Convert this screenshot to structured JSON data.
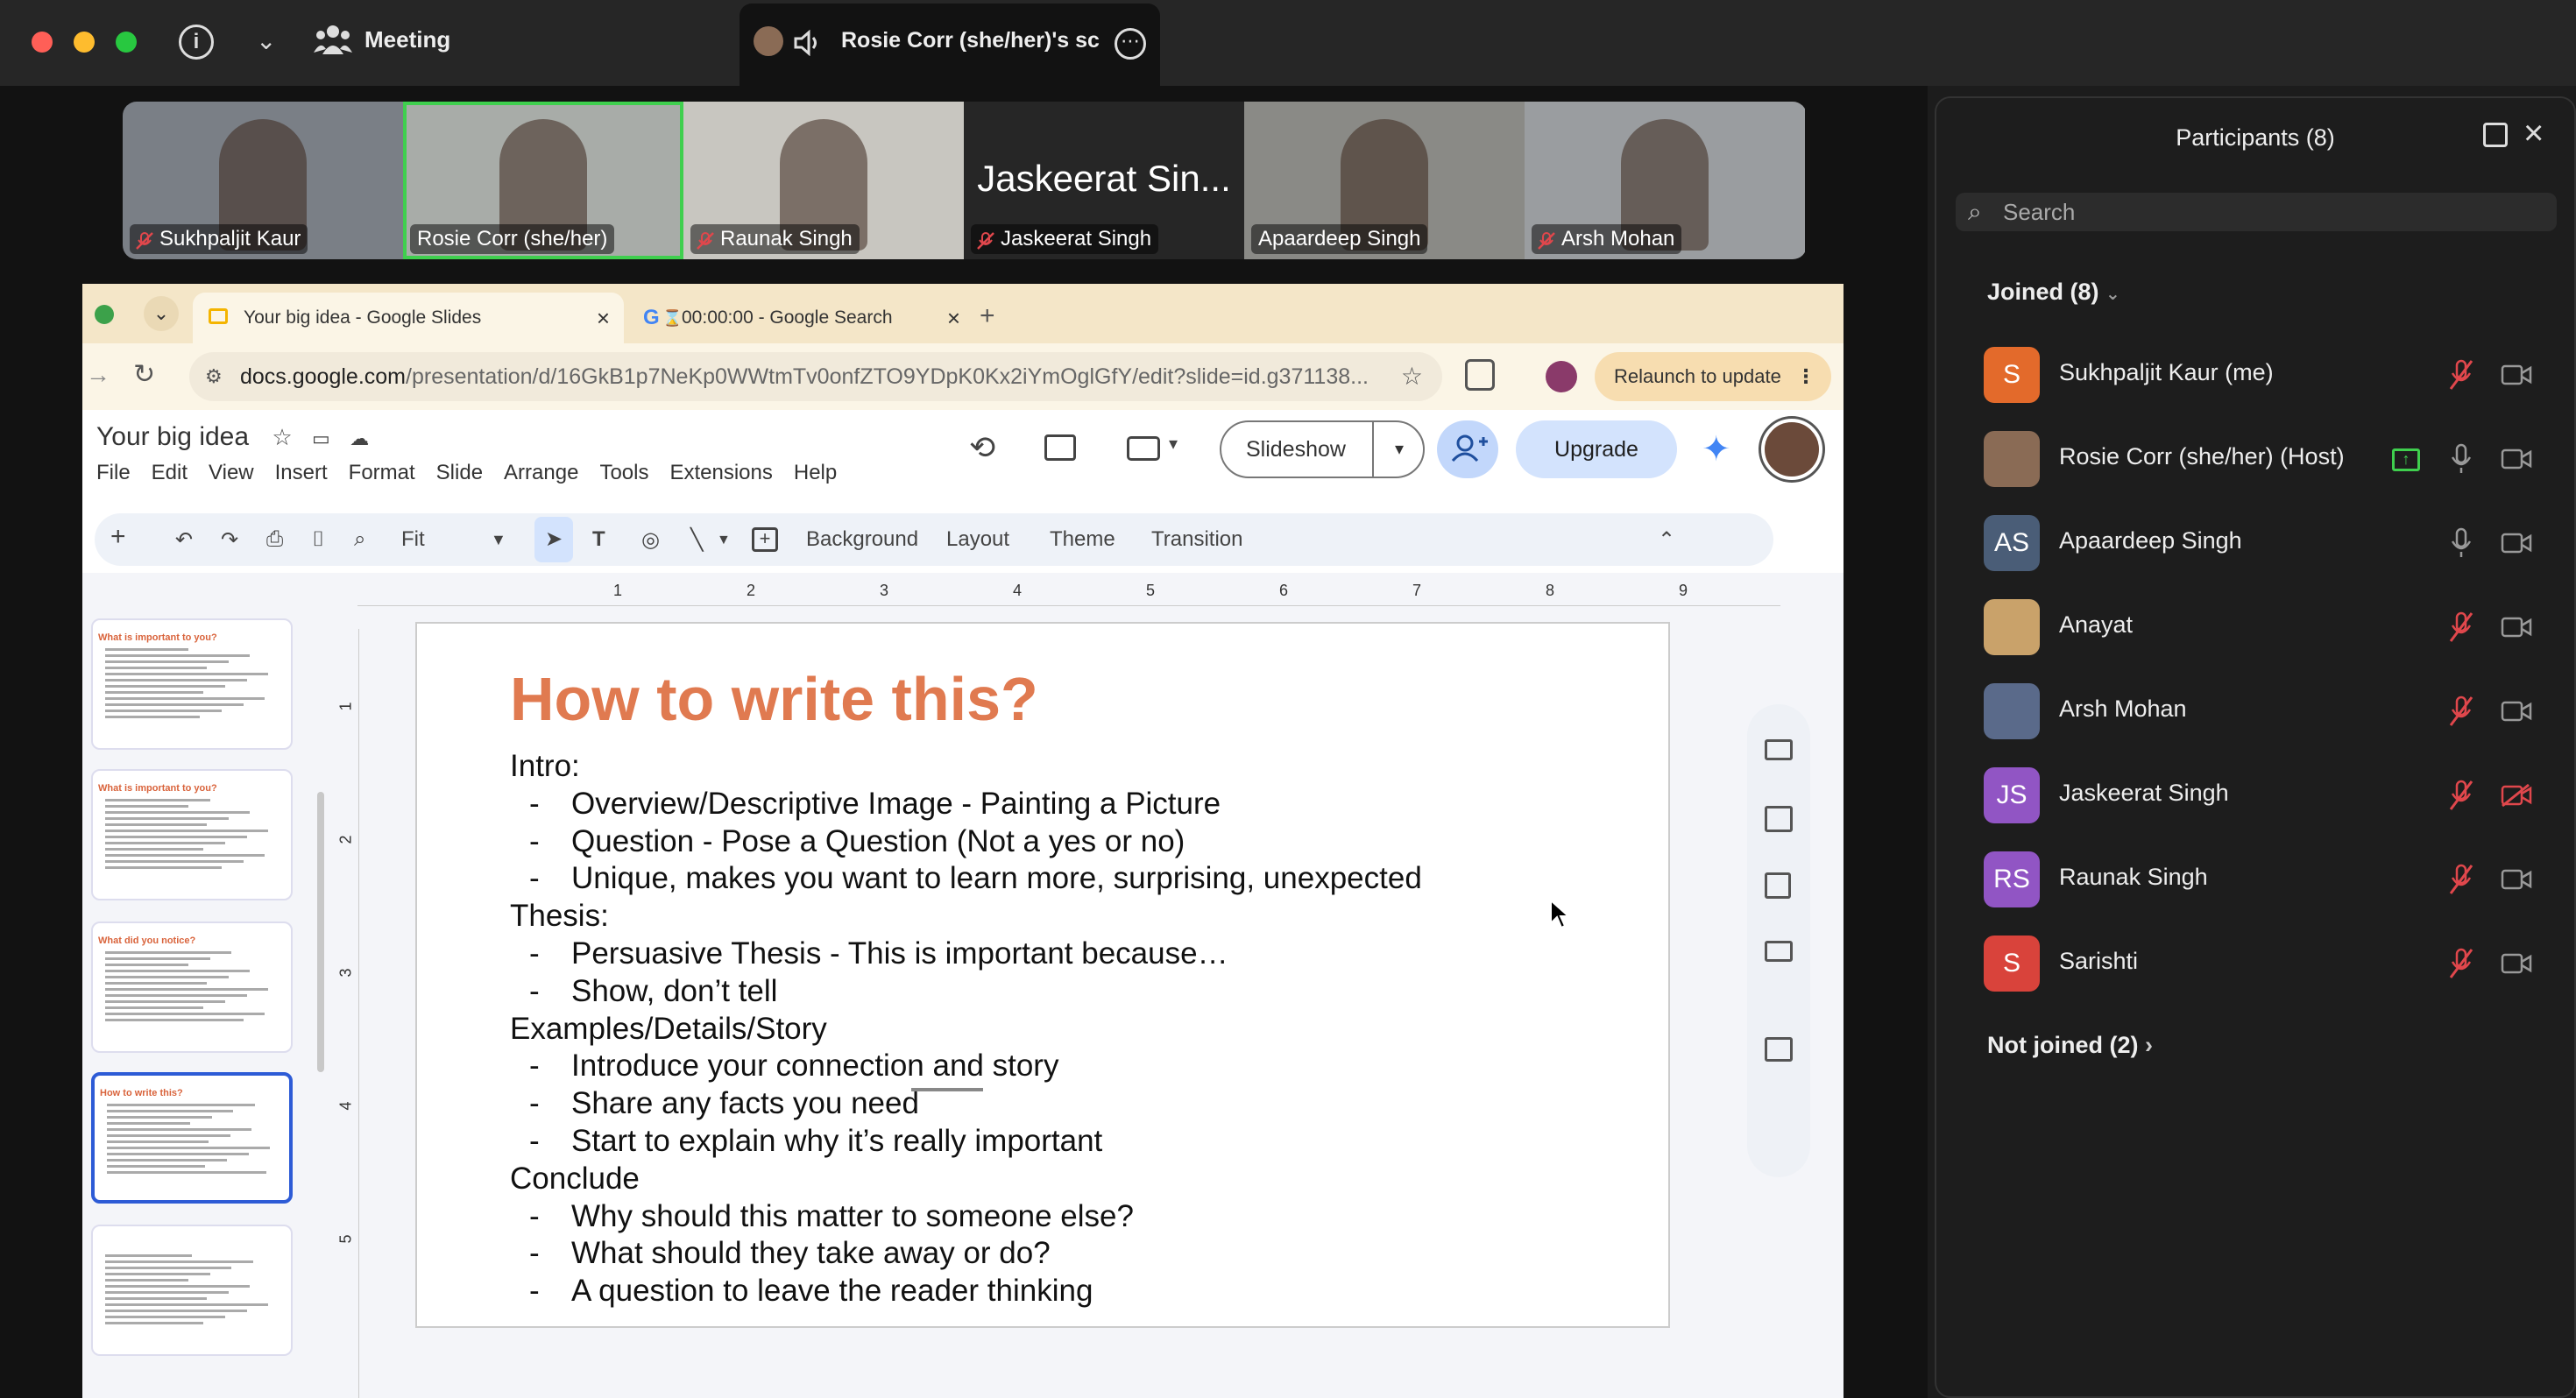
{
  "zoom": {
    "meeting_label": "Meeting",
    "share_label": "Rosie Corr (she/her)'s sc",
    "colors": {
      "active_speaker": "#3fcf4e",
      "mic_off": "#e0474c",
      "share": "#3fcf4e"
    }
  },
  "tiles": [
    {
      "name": "Sukhpaljit Kaur",
      "big": "",
      "muted": true
    },
    {
      "name": "Rosie Corr (she/her)",
      "big": "",
      "muted": false,
      "active": true
    },
    {
      "name": "Raunak Singh",
      "big": "",
      "muted": true
    },
    {
      "name": "Jaskeerat Singh",
      "big": "Jaskeerat Sin...",
      "muted": true
    },
    {
      "name": "Apaardeep Singh",
      "big": "",
      "muted": false
    },
    {
      "name": "Arsh Mohan",
      "big": "",
      "muted": true
    }
  ],
  "browser": {
    "tabs": [
      "Your big idea - Google Slides",
      "00:00:00 - Google Search"
    ],
    "new_tab": "+",
    "url_host": "docs.google.com",
    "url_path": "/presentation/d/16GkB1p7NeKp0WWtmTv0onfZTO9YDpK0Kx2iYmOglGfY/edit?slide=id.g371138...",
    "relaunch": "Relaunch to update"
  },
  "slides_app": {
    "title": "Your big idea",
    "menus": [
      "File",
      "Edit",
      "View",
      "Insert",
      "Format",
      "Slide",
      "Arrange",
      "Tools",
      "Extensions",
      "Help"
    ],
    "slideshow": "Slideshow",
    "upgrade": "Upgrade",
    "toolbar": {
      "zoom": "Fit",
      "background": "Background",
      "layout": "Layout",
      "theme": "Theme",
      "transition": "Transition"
    },
    "ruler_top": [
      "1",
      "2",
      "3",
      "4",
      "5",
      "6",
      "7",
      "8",
      "9"
    ],
    "ruler_left": [
      "1",
      "2",
      "3",
      "4",
      "5"
    ],
    "thumbnails": [
      {
        "title": "What is important to you?"
      },
      {
        "title": "What is important to you?"
      },
      {
        "title": "What did you notice?"
      },
      {
        "title": "How to write this?",
        "selected": true
      },
      {
        "title": ""
      }
    ]
  },
  "slide": {
    "title": "How to write this?",
    "title_color": "#e07a50",
    "sections": [
      {
        "heading": "Intro:",
        "bullets": [
          "Overview/Descriptive Image - Painting a Picture",
          "Question - Pose a Question (Not a yes or no)",
          "Unique, makes you want to learn more, surprising, unexpected"
        ]
      },
      {
        "heading": "Thesis:",
        "bullets": [
          "Persuasive Thesis - This is important because…",
          "Show, don’t tell"
        ]
      },
      {
        "heading": "Examples/Details/Story",
        "bullets": [
          "Introduce your connection and story",
          "Share any facts you need",
          "Start to explain why it’s really important"
        ]
      },
      {
        "heading": "Conclude",
        "bullets": [
          "Why should this matter to someone else?",
          "What should they take away or do?",
          "A question to leave the reader thinking"
        ]
      }
    ],
    "dash": "-"
  },
  "participants": {
    "title": "Participants (8)",
    "search_placeholder": "Search",
    "joined": "Joined (8)",
    "not_joined": "Not joined (2)",
    "list": [
      {
        "name": "Sukhpaljit Kaur (me)",
        "initials": "S",
        "color": "#e36a2b",
        "mic": "off",
        "cam": "on"
      },
      {
        "name": "Rosie Corr (she/her) (Host)",
        "initials": "",
        "color": "#8a6b55",
        "mic": "on",
        "cam": "on",
        "sharing": true
      },
      {
        "name": "Apaardeep Singh",
        "initials": "AS",
        "color": "#4a5d77",
        "mic": "on",
        "cam": "on"
      },
      {
        "name": "Anayat",
        "initials": "",
        "color": "#c9a26a",
        "mic": "off",
        "cam": "on"
      },
      {
        "name": "Arsh Mohan",
        "initials": "",
        "color": "#5a6a8a",
        "mic": "off",
        "cam": "on"
      },
      {
        "name": "Jaskeerat Singh",
        "initials": "JS",
        "color": "#9155c4",
        "mic": "off",
        "cam": "off"
      },
      {
        "name": "Raunak Singh",
        "initials": "RS",
        "color": "#9155c4",
        "mic": "off",
        "cam": "on"
      },
      {
        "name": "Sarishti",
        "initials": "S",
        "color": "#d9433b",
        "mic": "off",
        "cam": "on"
      }
    ]
  }
}
